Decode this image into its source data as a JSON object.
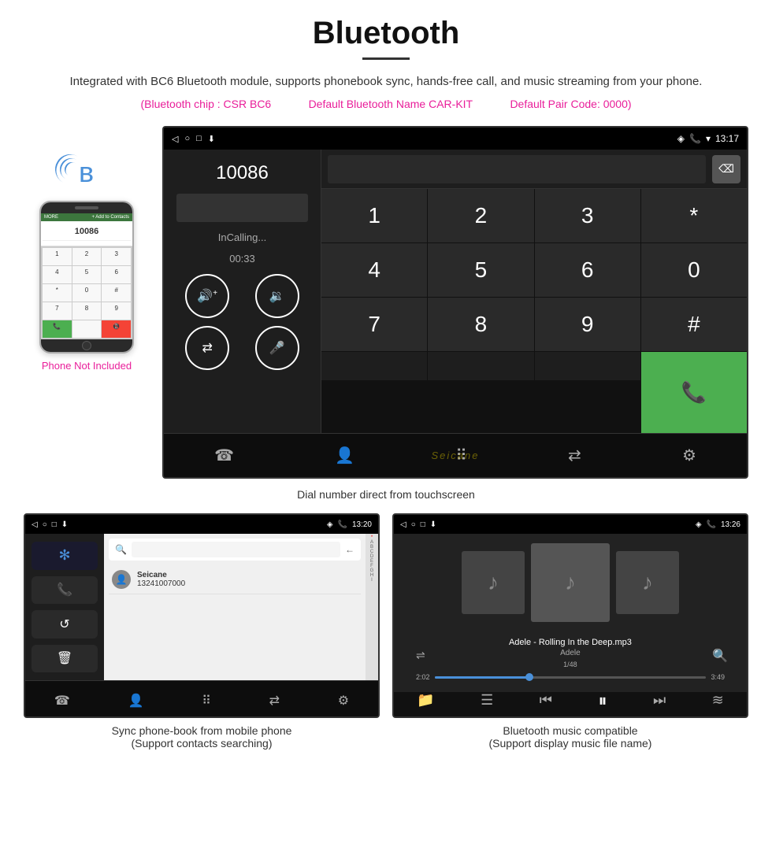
{
  "page": {
    "title": "Bluetooth",
    "description": "Integrated with BC6 Bluetooth module, supports phonebook sync, hands-free call, and music streaming from your phone.",
    "specs": {
      "chip": "(Bluetooth chip : CSR BC6",
      "name": "Default Bluetooth Name CAR-KIT",
      "code": "Default Pair Code: 0000)"
    },
    "dial_caption": "Dial number direct from touchscreen",
    "phonebook_caption": "Sync phone-book from mobile phone\n(Support contacts searching)",
    "music_caption": "Bluetooth music compatible\n(Support display music file name)"
  },
  "call_screen": {
    "time": "13:17",
    "number": "10086",
    "status": "InCalling...",
    "duration": "00:33",
    "keys": [
      "1",
      "2",
      "3",
      "*",
      "4",
      "5",
      "6",
      "0",
      "7",
      "8",
      "9",
      "#"
    ]
  },
  "phonebook_screen": {
    "time": "13:20",
    "contact_name": "Seicane",
    "contact_number": "13241007000",
    "alphabet": [
      "A",
      "B",
      "C",
      "D",
      "E",
      "F",
      "G",
      "H",
      "I"
    ]
  },
  "music_screen": {
    "time": "13:26",
    "song_title": "Adele - Rolling In the Deep.mp3",
    "artist": "Adele",
    "track_num": "1/48",
    "current_time": "2:02",
    "total_time": "3:49",
    "progress_percent": 35
  },
  "phone_aside": {
    "not_included": "Phone Not Included"
  },
  "icons": {
    "back": "◁",
    "home": "○",
    "square": "□",
    "download": "⬇",
    "location": "📍",
    "phone": "📞",
    "signal": "▲",
    "bluetooth": "⚡",
    "volume_up": "🔊",
    "volume_down": "🔉",
    "transfer": "⇄",
    "mic": "🎤",
    "contacts": "👤",
    "dialpad": "⠿",
    "settings": "⚙",
    "search": "🔍",
    "shuffle": "⇌",
    "prev": "⏮",
    "play": "▶",
    "pause": "⏸",
    "next": "⏭",
    "eq": "≡",
    "folder": "📁",
    "list": "☰",
    "music_note": "♪"
  }
}
